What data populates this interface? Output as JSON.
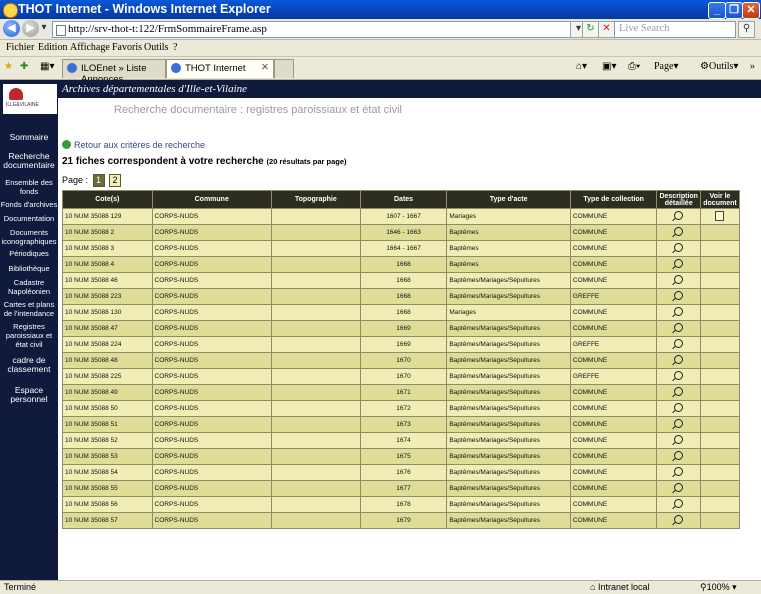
{
  "window": {
    "title": "THOT Internet - Windows Internet Explorer"
  },
  "browser": {
    "url": "http://srv-thot-t:122/FrmSommaireFrame.asp",
    "search_placeholder": "Live Search",
    "menu": [
      "Fichier",
      "Edition",
      "Affichage",
      "Favoris",
      "Outils",
      "?"
    ],
    "tabs": [
      {
        "label": "ILOEnet » Liste Annonces"
      },
      {
        "label": "THOT Internet"
      }
    ],
    "commands": {
      "page": "Page",
      "tools": "Outils"
    }
  },
  "site": {
    "header_title": "Archives départementales d'Ille-et-Vilaine",
    "subtitle": "Recherche documentaire : registres paroissiaux et état civil"
  },
  "sidebar": {
    "items": [
      "Sommaire",
      "Recherche documentaire",
      "Ensemble des fonds",
      "Fonds d'archives",
      "Documentation",
      "Documents iconographiques",
      "Périodiques",
      "Bibliothèque",
      "Cadastre Napoléonien",
      "Cartes et plans de l'intendance",
      "Registres paroissiaux et état civil",
      "cadre de classement",
      "Espace personnel"
    ]
  },
  "results": {
    "back_link": "Retour aux critères de recherche",
    "count_text": "21 fiches correspondent à votre recherche",
    "count_small": "(20 résultats par page)",
    "page_label": "Page :",
    "pages": [
      "1",
      "2"
    ],
    "columns": [
      "Cote(s)",
      "Commune",
      "Topographie",
      "Dates",
      "Type d'acte",
      "Type de collection",
      "Description détaillée",
      "Voir le document"
    ],
    "rows": [
      {
        "cote": "10 NUM 35088 129",
        "commune": "CORPS-NUDS",
        "dates": "1607 - 1667",
        "type": "Mariages",
        "collection": "COMMUNE",
        "doc": true
      },
      {
        "cote": "10 NUM 35088 2",
        "commune": "CORPS-NUDS",
        "dates": "1646 - 1663",
        "type": "Baptêmes",
        "collection": "COMMUNE",
        "doc": false
      },
      {
        "cote": "10 NUM 35088 3",
        "commune": "CORPS-NUDS",
        "dates": "1664 - 1667",
        "type": "Baptêmes",
        "collection": "COMMUNE",
        "doc": false
      },
      {
        "cote": "10 NUM 35088 4",
        "commune": "CORPS-NUDS",
        "dates": "1668",
        "type": "Baptêmes",
        "collection": "COMMUNE",
        "doc": false
      },
      {
        "cote": "10 NUM 35088 46",
        "commune": "CORPS-NUDS",
        "dates": "1668",
        "type": "Baptêmes/Mariages/Sépultures",
        "collection": "COMMUNE",
        "doc": false
      },
      {
        "cote": "10 NUM 35088 223",
        "commune": "CORPS-NUDS",
        "dates": "1668",
        "type": "Baptêmes/Mariages/Sépultures",
        "collection": "GREFFE",
        "doc": false
      },
      {
        "cote": "10 NUM 35088 130",
        "commune": "CORPS-NUDS",
        "dates": "1668",
        "type": "Mariages",
        "collection": "COMMUNE",
        "doc": false
      },
      {
        "cote": "10 NUM 35088 47",
        "commune": "CORPS-NUDS",
        "dates": "1669",
        "type": "Baptêmes/Mariages/Sépultures",
        "collection": "COMMUNE",
        "doc": false
      },
      {
        "cote": "10 NUM 35088 224",
        "commune": "CORPS-NUDS",
        "dates": "1669",
        "type": "Baptêmes/Mariages/Sépultures",
        "collection": "GREFFE",
        "doc": false
      },
      {
        "cote": "10 NUM 35088 48",
        "commune": "CORPS-NUDS",
        "dates": "1670",
        "type": "Baptêmes/Mariages/Sépultures",
        "collection": "COMMUNE",
        "doc": false
      },
      {
        "cote": "10 NUM 35088 225",
        "commune": "CORPS-NUDS",
        "dates": "1670",
        "type": "Baptêmes/Mariages/Sépultures",
        "collection": "GREFFE",
        "doc": false
      },
      {
        "cote": "10 NUM 35088 49",
        "commune": "CORPS-NUDS",
        "dates": "1671",
        "type": "Baptêmes/Mariages/Sépultures",
        "collection": "COMMUNE",
        "doc": false
      },
      {
        "cote": "10 NUM 35088 50",
        "commune": "CORPS-NUDS",
        "dates": "1672",
        "type": "Baptêmes/Mariages/Sépultures",
        "collection": "COMMUNE",
        "doc": false
      },
      {
        "cote": "10 NUM 35088 51",
        "commune": "CORPS-NUDS",
        "dates": "1673",
        "type": "Baptêmes/Mariages/Sépultures",
        "collection": "COMMUNE",
        "doc": false
      },
      {
        "cote": "10 NUM 35088 52",
        "commune": "CORPS-NUDS",
        "dates": "1674",
        "type": "Baptêmes/Mariages/Sépultures",
        "collection": "COMMUNE",
        "doc": false
      },
      {
        "cote": "10 NUM 35088 53",
        "commune": "CORPS-NUDS",
        "dates": "1675",
        "type": "Baptêmes/Mariages/Sépultures",
        "collection": "COMMUNE",
        "doc": false
      },
      {
        "cote": "10 NUM 35088 54",
        "commune": "CORPS-NUDS",
        "dates": "1676",
        "type": "Baptêmes/Mariages/Sépultures",
        "collection": "COMMUNE",
        "doc": false
      },
      {
        "cote": "10 NUM 35088 55",
        "commune": "CORPS-NUDS",
        "dates": "1677",
        "type": "Baptêmes/Mariages/Sépultures",
        "collection": "COMMUNE",
        "doc": false
      },
      {
        "cote": "10 NUM 35088 56",
        "commune": "CORPS-NUDS",
        "dates": "1678",
        "type": "Baptêmes/Mariages/Sépultures",
        "collection": "COMMUNE",
        "doc": false
      },
      {
        "cote": "10 NUM 35088 57",
        "commune": "CORPS-NUDS",
        "dates": "1679",
        "type": "Baptêmes/Mariages/Sépultures",
        "collection": "COMMUNE",
        "doc": false
      }
    ]
  },
  "status": {
    "text": "Terminé",
    "zone": "Intranet local",
    "zoom": "100%"
  }
}
